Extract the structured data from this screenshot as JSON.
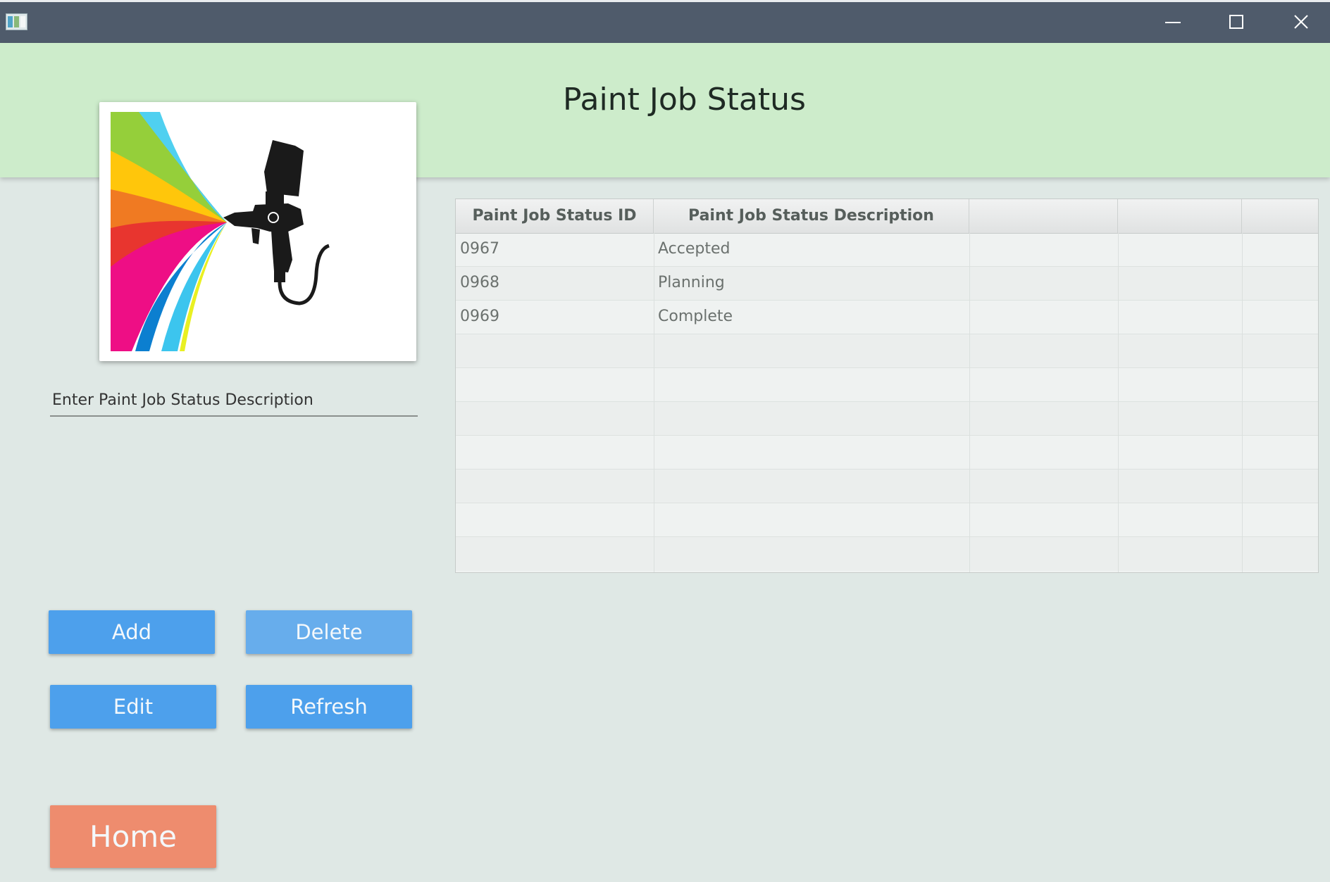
{
  "window": {
    "app_icon": "window-app-icon",
    "controls": [
      "minimize-icon",
      "maximize-icon",
      "close-icon"
    ]
  },
  "header": {
    "title": "Paint Job Status",
    "background_color": "#cdeccb"
  },
  "logo": {
    "icon": "spray-gun-rainbow-logo"
  },
  "form": {
    "description_placeholder": "Enter Paint Job Status Description",
    "description_value": ""
  },
  "table": {
    "columns": [
      "Paint Job Status ID",
      "Paint Job Status Description",
      "",
      "",
      ""
    ],
    "rows": [
      {
        "id": "0967",
        "description": "Accepted"
      },
      {
        "id": "0968",
        "description": "Planning"
      },
      {
        "id": "0969",
        "description": "Complete"
      }
    ]
  },
  "buttons": {
    "add": "Add",
    "delete": "Delete",
    "edit": "Edit",
    "refresh": "Refresh",
    "home": "Home"
  },
  "colors": {
    "titlebar": "#4f5b6b",
    "background": "#dfe8e5",
    "button_blue": "#4da0ec",
    "button_home": "#ee8c6e"
  }
}
